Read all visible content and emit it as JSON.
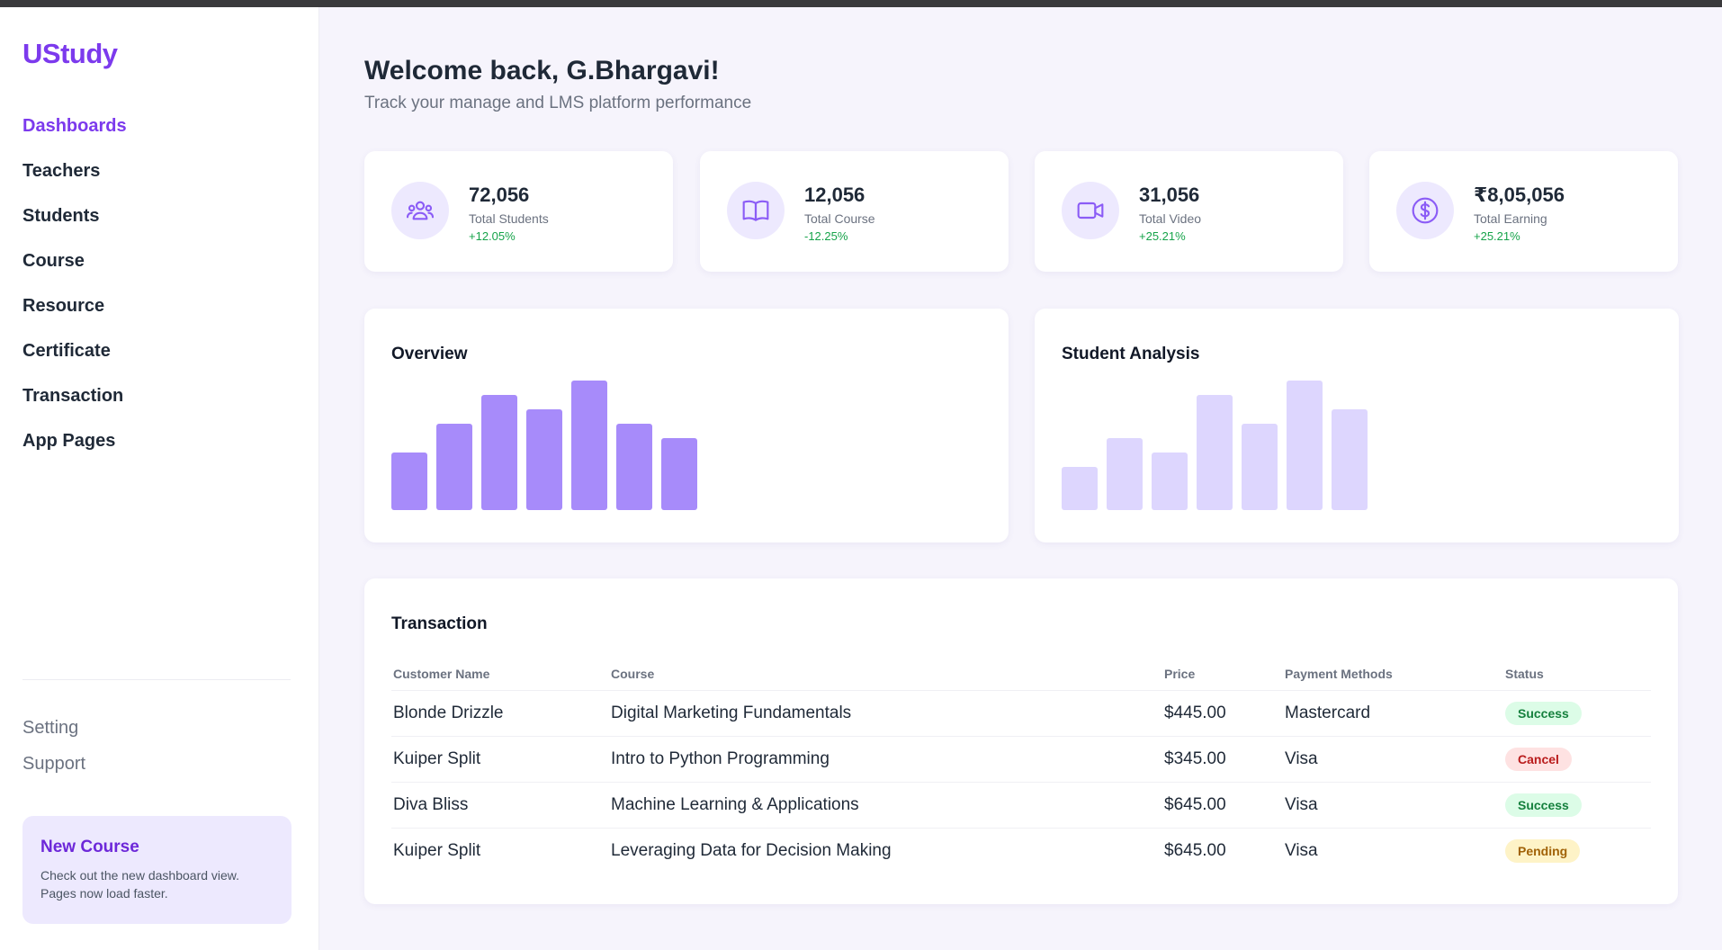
{
  "brand": "UStudy",
  "sidebar": {
    "items": [
      {
        "label": "Dashboards",
        "active": true
      },
      {
        "label": "Teachers"
      },
      {
        "label": "Students"
      },
      {
        "label": "Course"
      },
      {
        "label": "Resource"
      },
      {
        "label": "Certificate"
      },
      {
        "label": "Transaction"
      },
      {
        "label": "App Pages"
      }
    ],
    "secondary": [
      {
        "label": "Setting"
      },
      {
        "label": "Support"
      }
    ],
    "promo": {
      "title": "New Course",
      "text": "Check out the new dashboard view. Pages now load faster."
    }
  },
  "header": {
    "title": "Welcome back, G.Bhargavi!",
    "subtitle": "Track your manage and LMS platform performance"
  },
  "stats": [
    {
      "value": "72,056",
      "label": "Total Students",
      "change": "+12.05%",
      "icon": "users-icon"
    },
    {
      "value": "12,056",
      "label": "Total Course",
      "change": "-12.25%",
      "icon": "book-icon"
    },
    {
      "value": "31,056",
      "label": "Total Video",
      "change": "+25.21%",
      "icon": "video-icon"
    },
    {
      "value": "₹8,05,056",
      "label": "Total Earning",
      "change": "+25.21%",
      "icon": "dollar-icon"
    }
  ],
  "colors": {
    "accent": "#7c3aed",
    "bar_primary": "#a78bfa",
    "bar_light": "#ddd6fe",
    "positive": "#16a34a"
  },
  "chart_data": [
    {
      "type": "bar",
      "title": "Overview",
      "values": [
        4,
        6,
        8,
        7,
        9,
        6,
        5
      ]
    },
    {
      "type": "bar",
      "title": "Student Analysis",
      "values": [
        3,
        5,
        4,
        8,
        6,
        9,
        7
      ]
    }
  ],
  "transactions": {
    "title": "Transaction",
    "columns": [
      "Customer Name",
      "Course",
      "Price",
      "Payment Methods",
      "Status"
    ],
    "rows": [
      {
        "customer": "Blonde Drizzle",
        "course": "Digital Marketing Fundamentals",
        "price": "$445.00",
        "method": "Mastercard",
        "status": "Success"
      },
      {
        "customer": "Kuiper Split",
        "course": "Intro to Python Programming",
        "price": "$345.00",
        "method": "Visa",
        "status": "Cancel"
      },
      {
        "customer": "Diva Bliss",
        "course": "Machine Learning & Applications",
        "price": "$645.00",
        "method": "Visa",
        "status": "Success"
      },
      {
        "customer": "Kuiper Split",
        "course": "Leveraging Data for Decision Making",
        "price": "$645.00",
        "method": "Visa",
        "status": "Pending"
      }
    ]
  }
}
